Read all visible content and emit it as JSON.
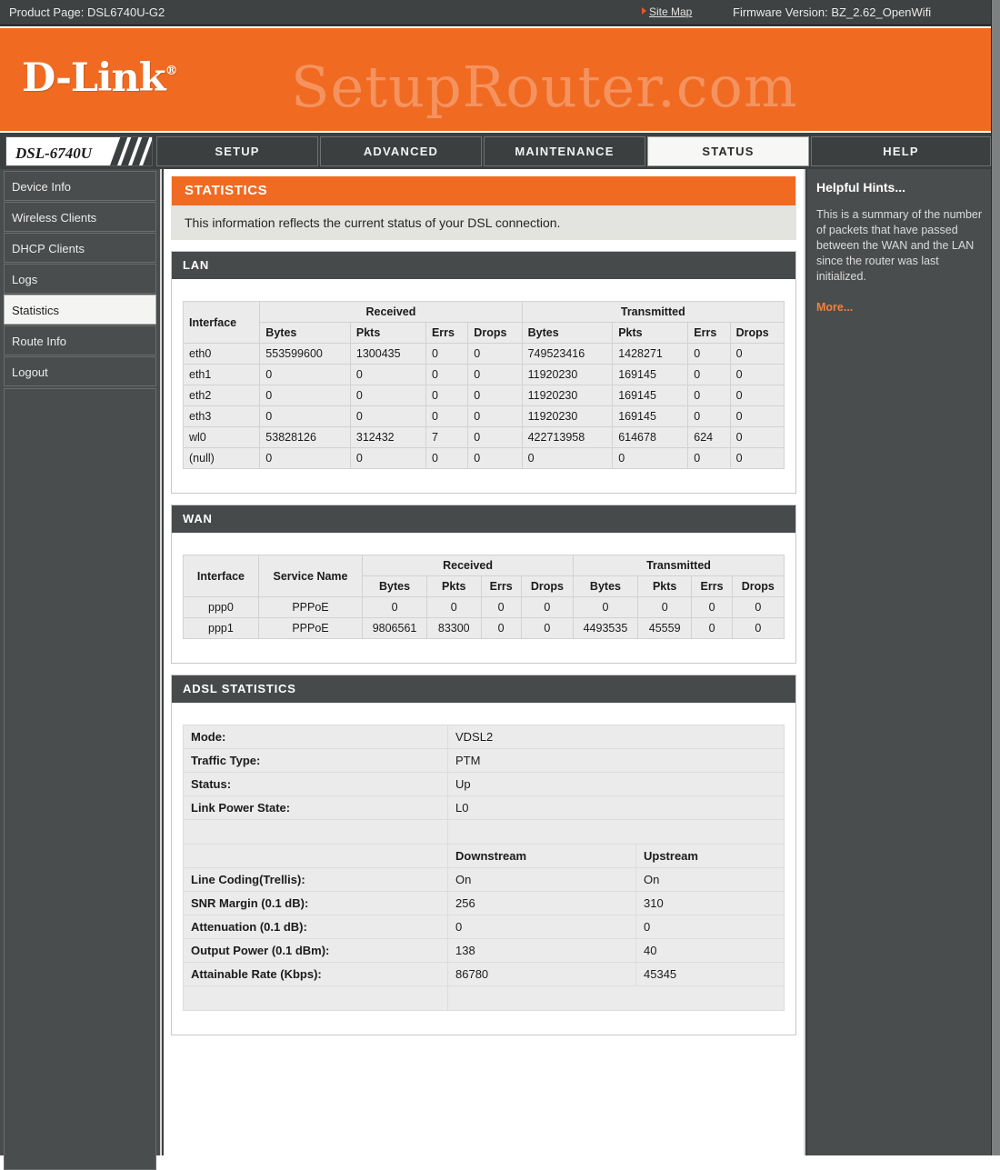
{
  "topbar": {
    "product_label": "Product Page: DSL6740U-G2",
    "site_map": "Site Map",
    "firmware": "Firmware Version: BZ_2.62_OpenWifi"
  },
  "brand": {
    "logo": "D-Link",
    "registered": "®",
    "watermark": "SetupRouter.com"
  },
  "nav": {
    "model": "DSL-6740U",
    "tabs": [
      {
        "label": "SETUP",
        "active": false
      },
      {
        "label": "ADVANCED",
        "active": false
      },
      {
        "label": "MAINTENANCE",
        "active": false
      },
      {
        "label": "STATUS",
        "active": true
      },
      {
        "label": "HELP",
        "active": false
      }
    ]
  },
  "sidebar": {
    "items": [
      {
        "label": "Device Info",
        "active": false
      },
      {
        "label": "Wireless Clients",
        "active": false
      },
      {
        "label": "DHCP Clients",
        "active": false
      },
      {
        "label": "Logs",
        "active": false
      },
      {
        "label": "Statistics",
        "active": true
      },
      {
        "label": "Route Info",
        "active": false
      },
      {
        "label": "Logout",
        "active": false
      }
    ]
  },
  "page": {
    "title": "STATISTICS",
    "description": "This information reflects the current status of your DSL connection."
  },
  "lan": {
    "heading": "LAN",
    "group_headers": {
      "interface": "Interface",
      "received": "Received",
      "transmitted": "Transmitted"
    },
    "sub_headers": [
      "Bytes",
      "Pkts",
      "Errs",
      "Drops",
      "Bytes",
      "Pkts",
      "Errs",
      "Drops"
    ],
    "rows": [
      {
        "interface": "eth0",
        "rx_bytes": "553599600",
        "rx_pkts": "1300435",
        "rx_errs": "0",
        "rx_drops": "0",
        "tx_bytes": "749523416",
        "tx_pkts": "1428271",
        "tx_errs": "0",
        "tx_drops": "0"
      },
      {
        "interface": "eth1",
        "rx_bytes": "0",
        "rx_pkts": "0",
        "rx_errs": "0",
        "rx_drops": "0",
        "tx_bytes": "11920230",
        "tx_pkts": "169145",
        "tx_errs": "0",
        "tx_drops": "0"
      },
      {
        "interface": "eth2",
        "rx_bytes": "0",
        "rx_pkts": "0",
        "rx_errs": "0",
        "rx_drops": "0",
        "tx_bytes": "11920230",
        "tx_pkts": "169145",
        "tx_errs": "0",
        "tx_drops": "0"
      },
      {
        "interface": "eth3",
        "rx_bytes": "0",
        "rx_pkts": "0",
        "rx_errs": "0",
        "rx_drops": "0",
        "tx_bytes": "11920230",
        "tx_pkts": "169145",
        "tx_errs": "0",
        "tx_drops": "0"
      },
      {
        "interface": "wl0",
        "rx_bytes": "53828126",
        "rx_pkts": "312432",
        "rx_errs": "7",
        "rx_drops": "0",
        "tx_bytes": "422713958",
        "tx_pkts": "614678",
        "tx_errs": "624",
        "tx_drops": "0"
      },
      {
        "interface": "(null)",
        "rx_bytes": "0",
        "rx_pkts": "0",
        "rx_errs": "0",
        "rx_drops": "0",
        "tx_bytes": "0",
        "tx_pkts": "0",
        "tx_errs": "0",
        "tx_drops": "0"
      }
    ]
  },
  "wan": {
    "heading": "WAN",
    "group_headers": {
      "interface": "Interface",
      "service_name": "Service Name",
      "received": "Received",
      "transmitted": "Transmitted"
    },
    "sub_headers": [
      "Bytes",
      "Pkts",
      "Errs",
      "Drops",
      "Bytes",
      "Pkts",
      "Errs",
      "Drops"
    ],
    "rows": [
      {
        "interface": "ppp0",
        "service": "PPPoE",
        "rx_bytes": "0",
        "rx_pkts": "0",
        "rx_errs": "0",
        "rx_drops": "0",
        "tx_bytes": "0",
        "tx_pkts": "0",
        "tx_errs": "0",
        "tx_drops": "0"
      },
      {
        "interface": "ppp1",
        "service": "PPPoE",
        "rx_bytes": "9806561",
        "rx_pkts": "83300",
        "rx_errs": "0",
        "rx_drops": "0",
        "tx_bytes": "4493535",
        "tx_pkts": "45559",
        "tx_errs": "0",
        "tx_drops": "0"
      }
    ]
  },
  "adsl": {
    "heading": "ADSL STATISTICS",
    "simple_rows": [
      {
        "label": "Mode:",
        "value": "VDSL2"
      },
      {
        "label": "Traffic Type:",
        "value": "PTM"
      },
      {
        "label": "Status:",
        "value": "Up"
      },
      {
        "label": "Link Power State:",
        "value": "L0"
      }
    ],
    "direction_headers": {
      "downstream": "Downstream",
      "upstream": "Upstream"
    },
    "direction_rows": [
      {
        "label": "Line Coding(Trellis):",
        "down": "On",
        "up": "On"
      },
      {
        "label": "SNR Margin (0.1 dB):",
        "down": "256",
        "up": "310"
      },
      {
        "label": "Attenuation (0.1 dB):",
        "down": "0",
        "up": "0"
      },
      {
        "label": "Output Power (0.1 dBm):",
        "down": "138",
        "up": "40"
      },
      {
        "label": "Attainable Rate (Kbps):",
        "down": "86780",
        "up": "45345"
      }
    ]
  },
  "hints": {
    "title": "Helpful Hints...",
    "body": "This is a summary of the number of packets that have passed between the WAN and the LAN since the router was last initialized.",
    "more": "More..."
  },
  "colors": {
    "brand_orange": "#f06a22",
    "dark_panel": "#4a4d4d",
    "section_head": "#474a4a",
    "table_cell": "#ebebeb",
    "more_link": "#f0813f"
  }
}
